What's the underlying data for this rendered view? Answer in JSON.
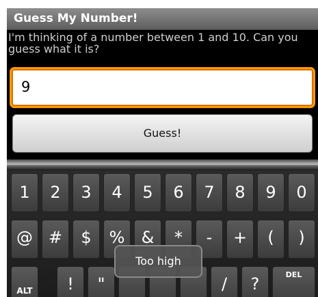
{
  "app": {
    "title": "Guess My Number!",
    "prompt": "I'm thinking of a number between 1 and 10. Can you guess what it is?",
    "input_value": "9",
    "guess_button": "Guess!",
    "toast": "Too high"
  },
  "keyboard": {
    "row1": [
      "1",
      "2",
      "3",
      "4",
      "5",
      "6",
      "7",
      "8",
      "9",
      "0"
    ],
    "row2": [
      "@",
      "#",
      "$",
      "%",
      "&",
      "*",
      "-",
      "+",
      "(",
      ")"
    ],
    "row3": [
      "ALT",
      "!",
      "\"",
      "",
      "",
      "",
      "/",
      "?",
      "DEL"
    ]
  },
  "colors": {
    "focus_border": "#ff9a00",
    "title_bar": "#6f6f6f"
  }
}
